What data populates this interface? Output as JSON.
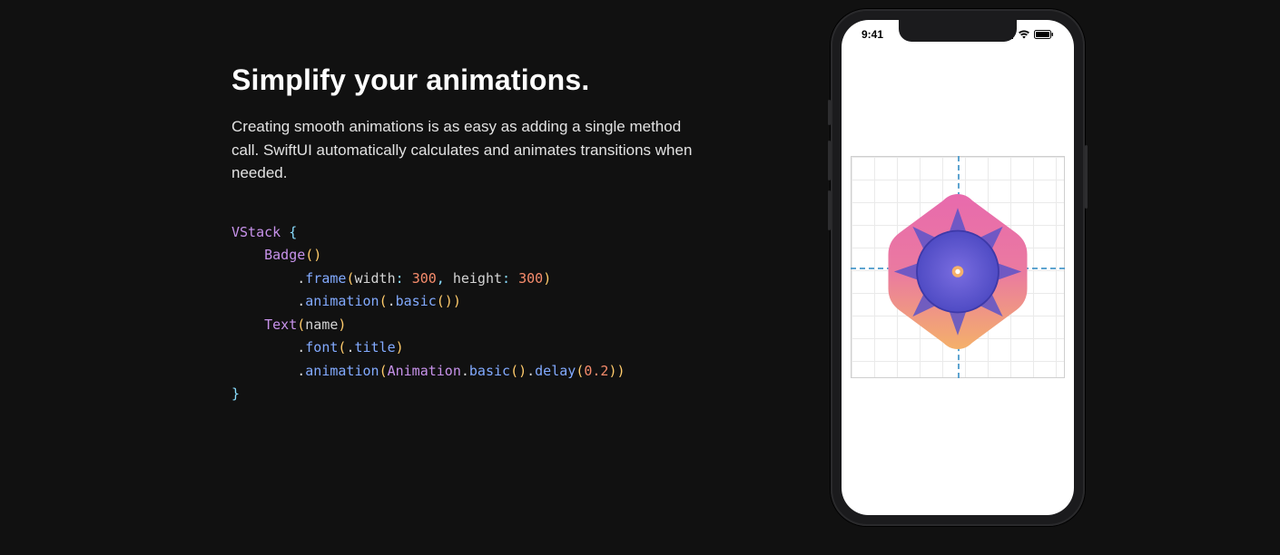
{
  "section": {
    "title": "Simplify your animations.",
    "description": "Creating smooth animations is as easy as adding a single method call. SwiftUI automatically calculates and animates transitions when needed."
  },
  "code": {
    "tokens": [
      {
        "t": "type",
        "v": "VStack"
      },
      {
        "t": "plain",
        "v": " "
      },
      {
        "t": "punc",
        "v": "{"
      },
      {
        "t": "nl"
      },
      {
        "t": "plain",
        "v": "    "
      },
      {
        "t": "type",
        "v": "Badge"
      },
      {
        "t": "paren",
        "v": "()"
      },
      {
        "t": "nl"
      },
      {
        "t": "plain",
        "v": "        "
      },
      {
        "t": "plain",
        "v": "."
      },
      {
        "t": "method",
        "v": "frame"
      },
      {
        "t": "paren",
        "v": "("
      },
      {
        "t": "plain",
        "v": "width"
      },
      {
        "t": "punc",
        "v": ":"
      },
      {
        "t": "plain",
        "v": " "
      },
      {
        "t": "num",
        "v": "300"
      },
      {
        "t": "punc",
        "v": ","
      },
      {
        "t": "plain",
        "v": " height"
      },
      {
        "t": "punc",
        "v": ":"
      },
      {
        "t": "plain",
        "v": " "
      },
      {
        "t": "num",
        "v": "300"
      },
      {
        "t": "paren",
        "v": ")"
      },
      {
        "t": "nl"
      },
      {
        "t": "plain",
        "v": "        "
      },
      {
        "t": "plain",
        "v": "."
      },
      {
        "t": "method",
        "v": "animation"
      },
      {
        "t": "paren",
        "v": "("
      },
      {
        "t": "plain",
        "v": "."
      },
      {
        "t": "method",
        "v": "basic"
      },
      {
        "t": "paren",
        "v": "()"
      },
      {
        "t": "paren",
        "v": ")"
      },
      {
        "t": "nl"
      },
      {
        "t": "plain",
        "v": "    "
      },
      {
        "t": "type",
        "v": "Text"
      },
      {
        "t": "paren",
        "v": "("
      },
      {
        "t": "plain",
        "v": "name"
      },
      {
        "t": "paren",
        "v": ")"
      },
      {
        "t": "nl"
      },
      {
        "t": "plain",
        "v": "        "
      },
      {
        "t": "plain",
        "v": "."
      },
      {
        "t": "method",
        "v": "font"
      },
      {
        "t": "paren",
        "v": "("
      },
      {
        "t": "plain",
        "v": "."
      },
      {
        "t": "method",
        "v": "title"
      },
      {
        "t": "paren",
        "v": ")"
      },
      {
        "t": "nl"
      },
      {
        "t": "plain",
        "v": "        "
      },
      {
        "t": "plain",
        "v": "."
      },
      {
        "t": "method",
        "v": "animation"
      },
      {
        "t": "paren",
        "v": "("
      },
      {
        "t": "type",
        "v": "Animation"
      },
      {
        "t": "plain",
        "v": "."
      },
      {
        "t": "method",
        "v": "basic"
      },
      {
        "t": "paren",
        "v": "()"
      },
      {
        "t": "plain",
        "v": "."
      },
      {
        "t": "method",
        "v": "delay"
      },
      {
        "t": "paren",
        "v": "("
      },
      {
        "t": "num",
        "v": "0.2"
      },
      {
        "t": "paren",
        "v": ")"
      },
      {
        "t": "paren",
        "v": ")"
      },
      {
        "t": "nl"
      },
      {
        "t": "punc",
        "v": "}"
      }
    ]
  },
  "phone": {
    "time": "9:41",
    "icons": {
      "signal": "signal-icon",
      "wifi": "wifi-icon",
      "battery": "battery-icon"
    }
  }
}
